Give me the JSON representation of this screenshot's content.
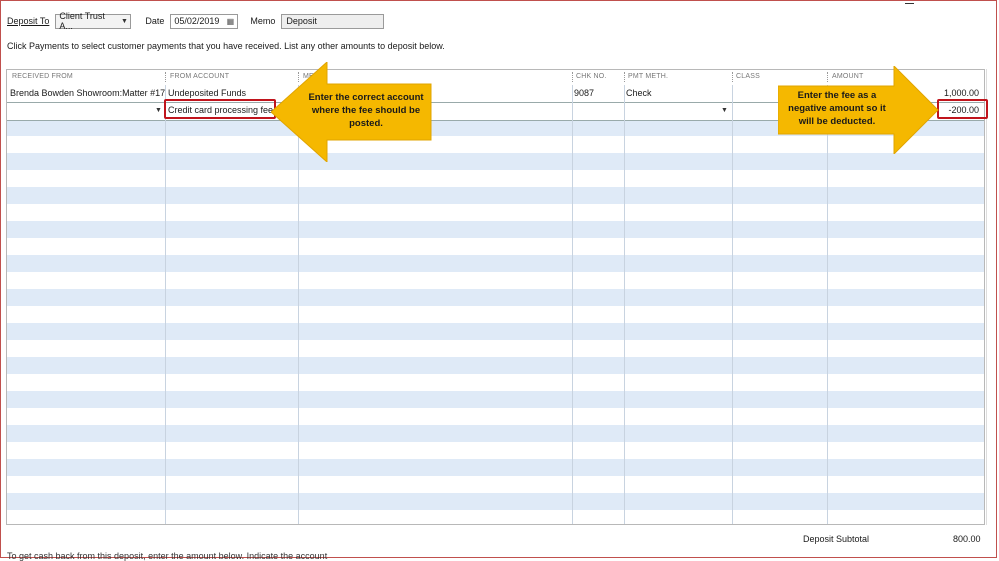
{
  "toolbar": {
    "deposit_to_label": "Deposit To",
    "deposit_to_value": "Client Trust A...",
    "date_label": "Date",
    "date_value": "05/02/2019",
    "memo_label": "Memo",
    "memo_value": "Deposit"
  },
  "instruction": "Click Payments to select customer payments that you have received. List any other amounts to deposit below.",
  "columns": [
    "RECEIVED FROM",
    "FROM ACCOUNT",
    "ME",
    "CHK NO.",
    "PMT METH.",
    "CLASS",
    "AMOUNT"
  ],
  "rows": [
    {
      "received_from": "Brenda Bowden Showroom:Matter #17",
      "from_account": "Undeposited Funds",
      "chk_no": "9087",
      "pmt_meth": "Check",
      "amount": "1,000.00"
    },
    {
      "received_from": "",
      "from_account": "Credit card processing fee",
      "chk_no": "",
      "pmt_meth": "",
      "amount": "-200.00"
    }
  ],
  "callouts": {
    "left": "Enter the correct account where the fee should be posted.",
    "right": "Enter the fee as a negative amount so it will be deducted."
  },
  "footer": {
    "subtotal_label": "Deposit Subtotal",
    "subtotal_value": "800.00",
    "cashback_text": "To get cash back from this deposit, enter the amount below.  Indicate the account"
  },
  "colors": {
    "callout_fill": "#f5b800",
    "highlight_border": "#c0141c",
    "row_stripe": "#dfeaf7"
  }
}
